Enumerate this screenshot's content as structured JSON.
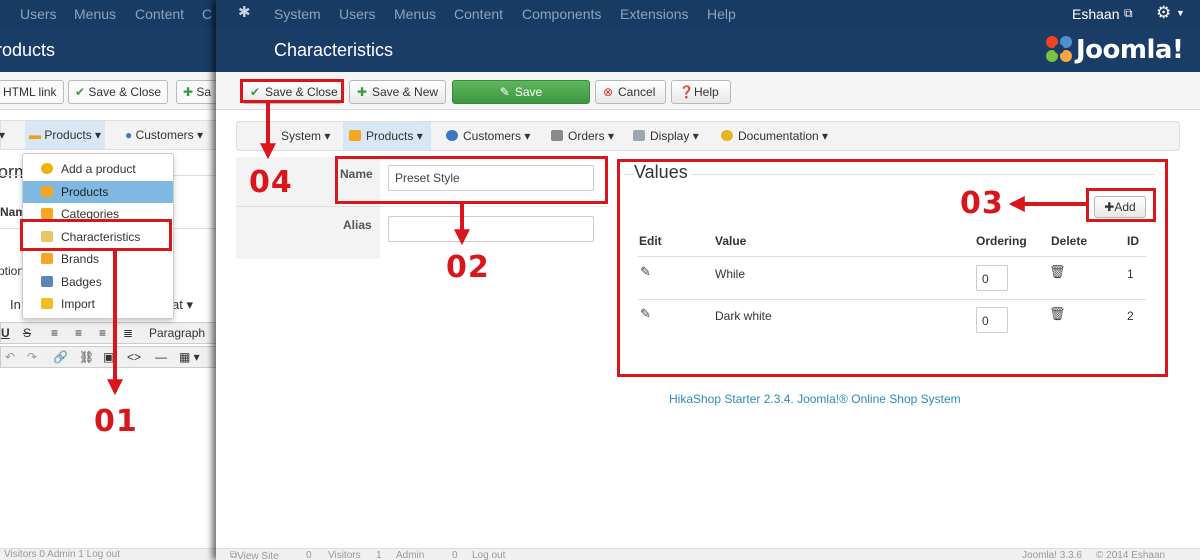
{
  "background_window": {
    "topnav": [
      "Users",
      "Menus",
      "Content",
      "C"
    ],
    "title": "roducts",
    "toolbar": {
      "html_link": "HTML link",
      "save_close": "Save & Close",
      "save_trunc": "Sa"
    },
    "menubar": {
      "products": "Products",
      "customers": "Customers"
    },
    "dropdown": [
      "Add a product",
      "Products",
      "Categories",
      "Characteristics",
      "Brands",
      "Badges",
      "Import"
    ],
    "form_fragments": {
      "heading": "orm",
      "name": "Nam",
      "options": "ption",
      "insert": "In",
      "format": "at"
    },
    "editor": {
      "paragraph": "Paragraph"
    },
    "status": "Visitors  0  Admin  1  Log out"
  },
  "topnav": {
    "items": [
      "System",
      "Users",
      "Menus",
      "Content",
      "Components",
      "Extensions",
      "Help"
    ],
    "user": "Eshaan"
  },
  "page": {
    "title": "Characteristics",
    "brand": "Joomla!"
  },
  "toolbar": {
    "save_close": "Save & Close",
    "save_new": "Save & New",
    "save": "Save",
    "cancel": "Cancel",
    "help": "Help"
  },
  "submenu": {
    "items": [
      "System",
      "Products",
      "Customers",
      "Orders",
      "Display",
      "Documentation"
    ],
    "active": "Products"
  },
  "form": {
    "name_label": "Name",
    "name_value": "Preset Style",
    "alias_label": "Alias",
    "alias_value": ""
  },
  "values": {
    "legend": "Values",
    "add_label": "Add",
    "headers": [
      "Edit",
      "Value",
      "Ordering",
      "Delete",
      "ID"
    ],
    "rows": [
      {
        "value": "While",
        "ordering": "0",
        "id": "1"
      },
      {
        "value": "Dark white",
        "ordering": "0",
        "id": "2"
      }
    ]
  },
  "footer": "HikaShop Starter 2.3.4. Joomla!® Online Shop System",
  "status_bar": {
    "view_site": "View Site",
    "visitors_count": "0",
    "visitors": "Visitors",
    "admin_count": "1",
    "admin": "Admin",
    "logout_count": "0",
    "logout": "Log out",
    "version": "Joomla! 3.3.6",
    "copyright": "© 2014 Eshaan"
  },
  "annotations": [
    "01",
    "02",
    "03",
    "04"
  ],
  "colors": {
    "annotation": "#d9161c",
    "header_bg": "#1a3d68",
    "nav_bg": "#183b63",
    "green": "#5cb85c",
    "link": "#2a8ab8"
  }
}
